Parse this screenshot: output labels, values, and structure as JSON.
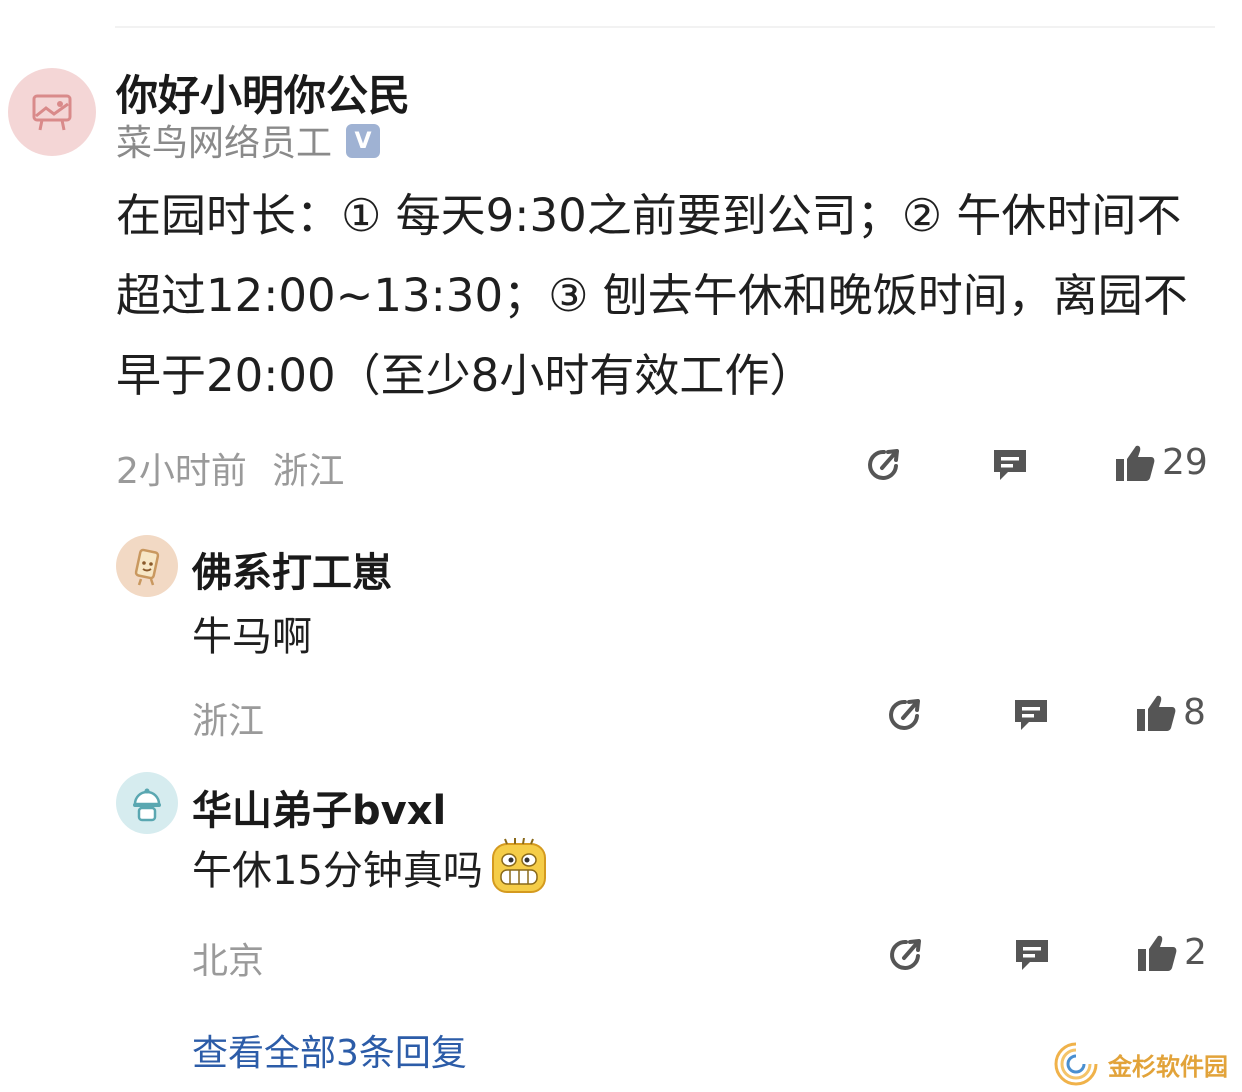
{
  "post": {
    "author": "你好小明你公民",
    "subtitle": "菜鸟网络员工",
    "verified_badge": "V",
    "content": "在园时长：① 每天9:30之前要到公司；② 午休时间不超过12:00~13:30；③ 刨去午休和晚饭时间，离园不早于20:00（至少8小时有效工作）",
    "time": "2小时前",
    "location": "浙江",
    "likes": "29"
  },
  "replies": [
    {
      "author": "佛系打工崽",
      "text": "牛马啊",
      "location": "浙江",
      "likes": "8"
    },
    {
      "author": "华山弟子bvxl",
      "text": "午休15分钟真吗",
      "location": "北京",
      "likes": "2"
    }
  ],
  "more_replies": "查看全部3条回复",
  "watermark": "金杉软件园",
  "icons": [
    "share-icon",
    "comment-icon",
    "thumbs-up-icon"
  ]
}
